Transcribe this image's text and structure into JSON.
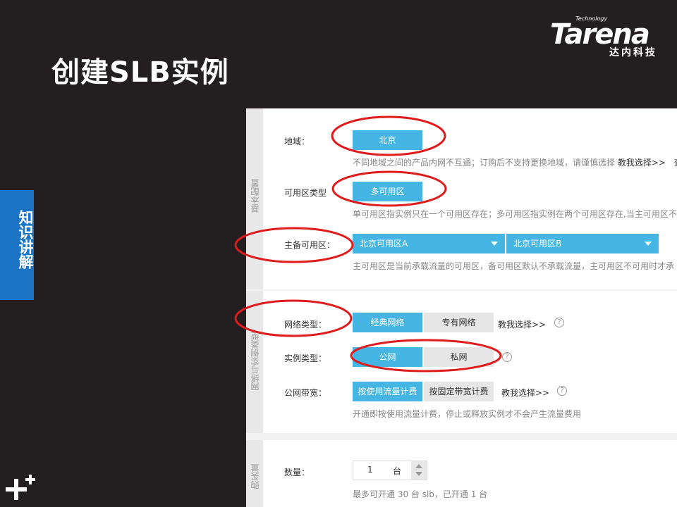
{
  "slide": {
    "title": "创建SLB实例",
    "side_tab": "知识讲解"
  },
  "logo": {
    "brand": "Tarena",
    "tagline": "Technology",
    "chinese": "达内科技"
  },
  "colors": {
    "background": "#231f20",
    "side_tab": "#1b73c6",
    "selected": "#45b6e3",
    "annotation": "#e01b1b"
  },
  "basic": {
    "section_label": "基本配置",
    "region": {
      "label": "地域：",
      "value": "北京",
      "desc": "不同地域之间的产品内网不互通；订购后不支持更换地域，请谨慎选择",
      "help_link": "教我选择>>",
      "trailing": "查"
    },
    "zone_type": {
      "label": "可用区类型",
      "value": "多可用区",
      "desc": "单可用区指实例只在一个可用区存在；多可用区指实例在两个可用区存在,当主可用区不"
    },
    "master_slave": {
      "label": "主备可用区：",
      "primary": "北京可用区A",
      "secondary": "北京可用区B",
      "desc": "主可用区是当前承载流量的可用区，备可用区默认不承载流量，主可用区不可用时才承"
    }
  },
  "network": {
    "section_label": "网络与实例类型",
    "net_type": {
      "label": "网络类型：",
      "options": [
        "经典网络",
        "专有网络"
      ],
      "selected": "经典网络",
      "help_link": "教我选择>>"
    },
    "instance_type": {
      "label": "实例类型：",
      "options": [
        "公网",
        "私网"
      ],
      "selected": "公网"
    },
    "bandwidth": {
      "label": "公网带宽：",
      "options": [
        "按使用流量计费",
        "按固定带宽计费"
      ],
      "selected": "按使用流量计费",
      "help_link": "教我选择>>",
      "desc": "开通即按使用流量计费，停止或释放实例才不会产生流量费用"
    }
  },
  "purchase": {
    "section_label": "购买量",
    "quantity": {
      "label": "数量：",
      "value": "1",
      "unit": "台",
      "desc": "最多可开通 30 台 slb，已开通 1 台"
    }
  }
}
